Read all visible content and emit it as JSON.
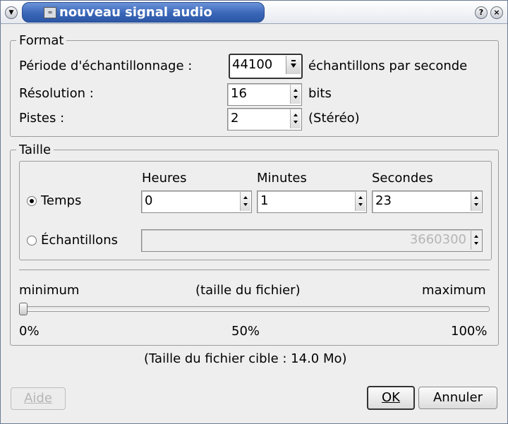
{
  "window": {
    "title": "nouveau signal audio",
    "app_icon": "wave-icon",
    "help_icon": "?",
    "close_icon": "×"
  },
  "format": {
    "title": "Format",
    "sample_rate_label": "Période d'échantillonnage :",
    "sample_rate_value": "44100",
    "sample_rate_unit": "échantillons par seconde",
    "resolution_label": "Résolution :",
    "resolution_value": "16",
    "resolution_unit": "bits",
    "tracks_label": "Pistes :",
    "tracks_value": "2",
    "tracks_unit": "(Stéréo)"
  },
  "size": {
    "title": "Taille",
    "col_hours": "Heures",
    "col_minutes": "Minutes",
    "col_seconds": "Secondes",
    "time_label": "Temps",
    "time_selected": true,
    "hours_value": "0",
    "minutes_value": "1",
    "seconds_value": "23",
    "samples_label": "Échantillons",
    "samples_value": "3660300",
    "slider_min_label": "minimum",
    "slider_mid_label": "(taille du fichier)",
    "slider_max_label": "maximum",
    "slider_value": 0,
    "tick_0": "0%",
    "tick_50": "50%",
    "tick_100": "100%"
  },
  "target_size_text": "(Taille du fichier cible : 14.0 Mo)",
  "buttons": {
    "help": "Aide",
    "ok": "OK",
    "cancel": "Annuler"
  }
}
